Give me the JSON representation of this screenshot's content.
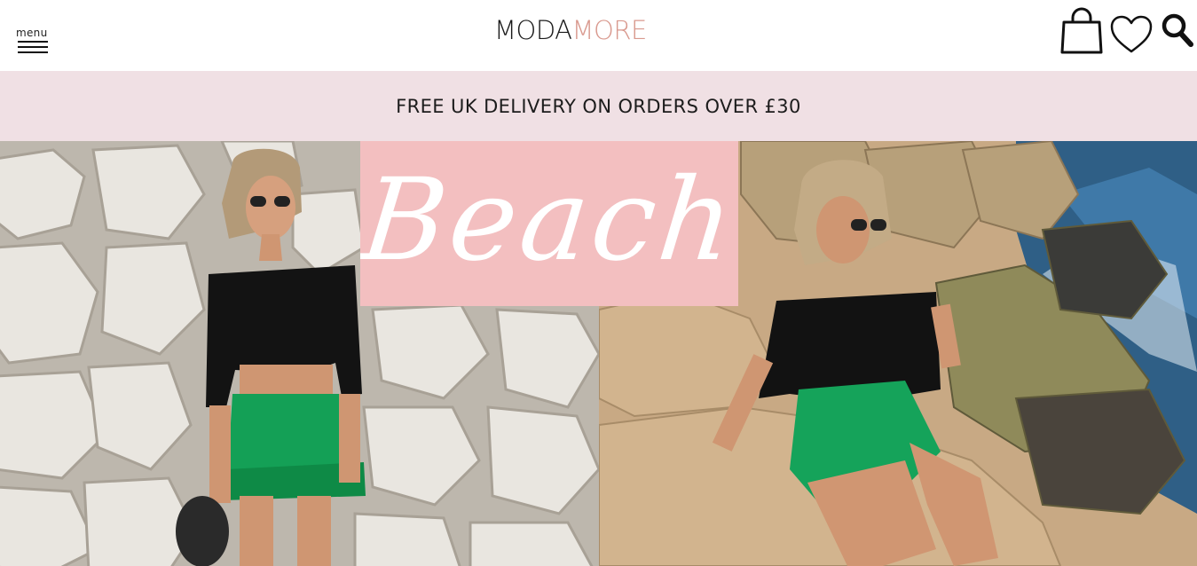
{
  "header": {
    "menu_label": "menu",
    "logo": {
      "part1": "MODA",
      "part2": "MORE",
      "part1_color": "#1a1a1a",
      "part2_color": "#d9998e"
    },
    "icons": [
      "shopping-bag-icon",
      "heart-icon",
      "search-icon"
    ]
  },
  "promo": {
    "text": "FREE UK DELIVERY ON ORDERS OVER £30",
    "background": "#f0e0e4"
  },
  "hero": {
    "headline": "Beach",
    "headline_box_color": "#f3bfc0"
  }
}
